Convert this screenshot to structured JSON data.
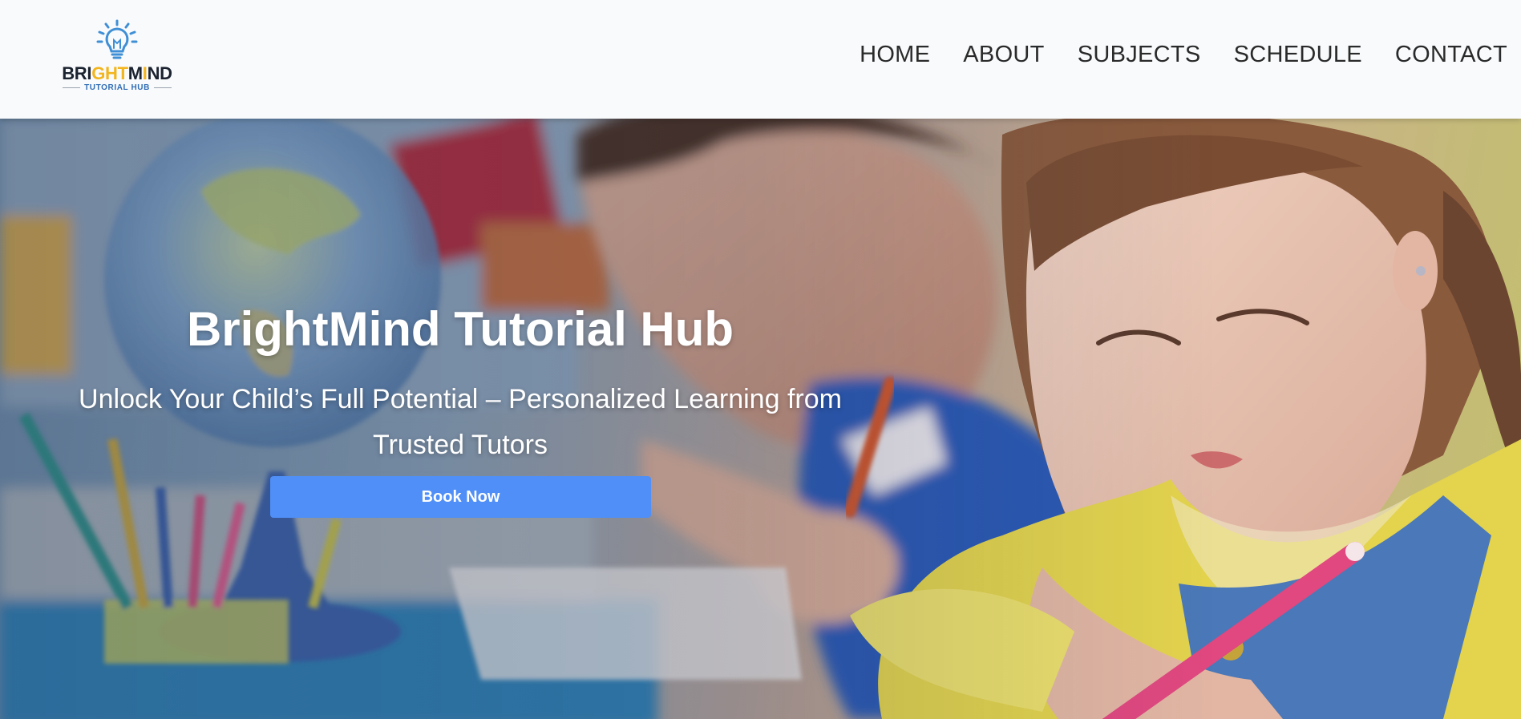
{
  "header": {
    "logo": {
      "word_part1": "BRI",
      "word_part2": "GHT",
      "word_part3": "M",
      "word_part4": "I",
      "word_part5": "ND",
      "subtitle": "TUTORIAL HUB",
      "icon": "lightbulb-icon"
    },
    "nav": [
      {
        "label": "HOME"
      },
      {
        "label": "ABOUT"
      },
      {
        "label": "SUBJECTS"
      },
      {
        "label": "SCHEDULE"
      },
      {
        "label": "CONTACT"
      }
    ]
  },
  "hero": {
    "title": "BrightMind Tutorial Hub",
    "subtitle": "Unlock Your Child’s Full Potential – Personalized Learning from Trusted Tutors",
    "cta_label": "Book Now",
    "background": "classroom-photo-children-writing"
  },
  "colors": {
    "accent": "#4f8ff7",
    "brand_gold": "#f2b51d",
    "brand_blue": "#2f6db5",
    "header_bg": "#f9fafc"
  }
}
